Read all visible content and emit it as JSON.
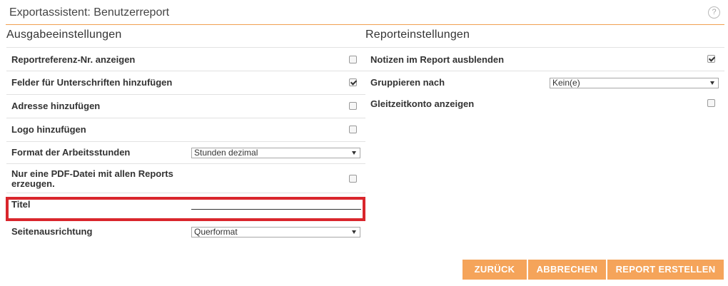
{
  "header": {
    "title": "Exportassistent: Benutzerreport",
    "help_icon": "?"
  },
  "output": {
    "title": "Ausgabeeinstellungen",
    "rows": [
      {
        "label": "Reportreferenz-Nr. anzeigen",
        "checked": false
      },
      {
        "label": "Felder für Unterschriften hinzufügen",
        "checked": true
      },
      {
        "label": "Adresse hinzufügen",
        "checked": false
      },
      {
        "label": "Logo hinzufügen",
        "checked": false
      },
      {
        "label": "Format der Arbeitsstunden",
        "value": "Stunden dezimal"
      },
      {
        "label": "Nur eine PDF-Datei mit allen Reports erzeugen.",
        "checked": false
      },
      {
        "label": "Titel",
        "value": ""
      },
      {
        "label": "Seitenausrichtung",
        "value": "Querformat"
      }
    ]
  },
  "report": {
    "title": "Reporteinstellungen",
    "rows": [
      {
        "label": "Notizen im Report ausblenden",
        "checked": true
      },
      {
        "label": "Gruppieren nach",
        "value": "Kein(e)"
      },
      {
        "label": "Gleitzeitkonto anzeigen",
        "checked": false
      }
    ]
  },
  "buttons": {
    "back": "ZURÜCK",
    "cancel": "ABBRECHEN",
    "create": "REPORT ERSTELLEN"
  },
  "colors": {
    "accent": "#f5a45a",
    "highlight": "#d9262c",
    "header_line": "#f0a050"
  }
}
